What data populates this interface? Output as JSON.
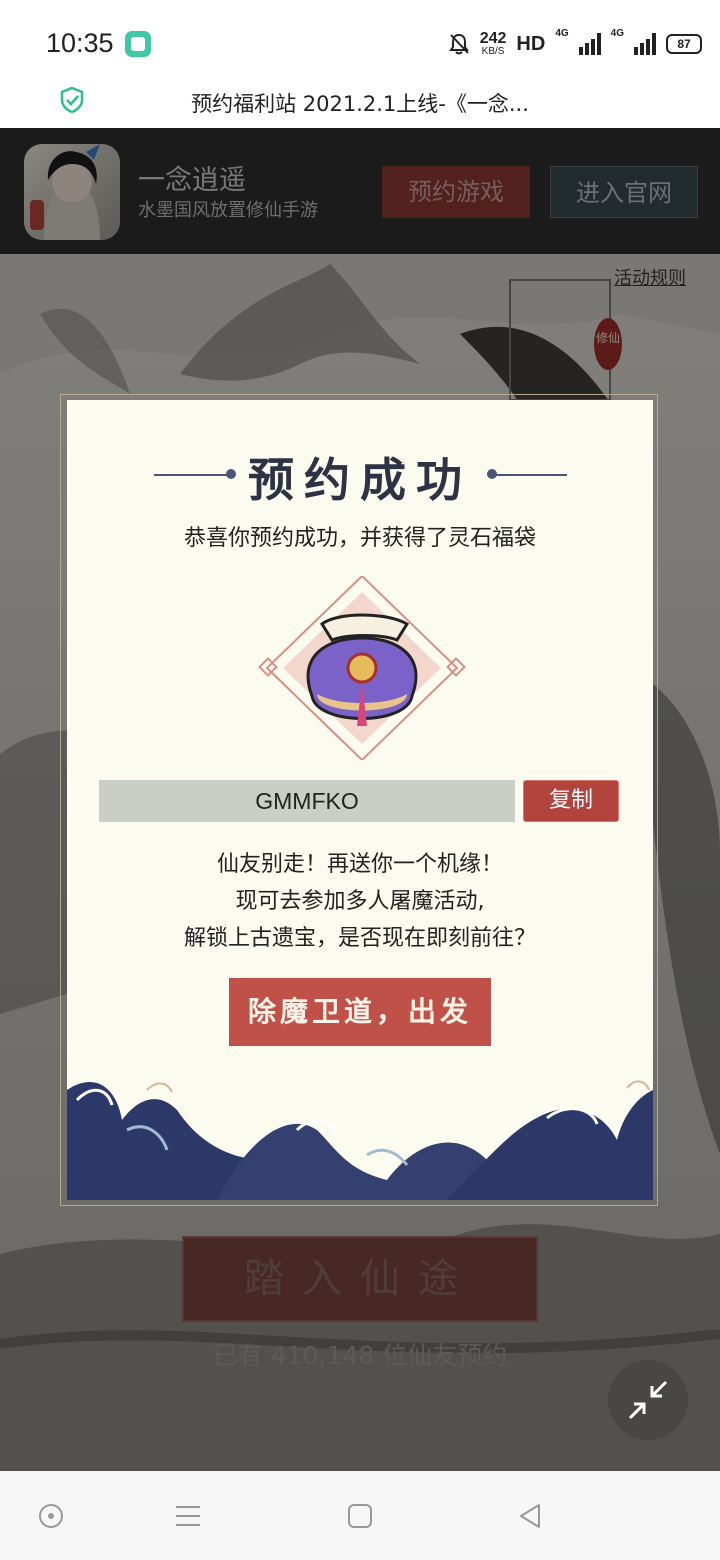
{
  "status_bar": {
    "time": "10:35",
    "speed_value": "242",
    "speed_unit": "KB/S",
    "hd_label": "HD",
    "net1": "4G",
    "net2": "4G",
    "battery": "87"
  },
  "url_bar": {
    "title": "预约福利站 2021.2.1上线-《一念..."
  },
  "header": {
    "game_name": "一念逍遥",
    "game_subtitle": "水墨国风放置修仙手游",
    "reserve_button": "预约游戏",
    "official_button": "进入官网"
  },
  "page": {
    "rules_link": "活动规则",
    "enter_button": "踏入仙途",
    "reserve_count": "已有 410,148 位仙友预约",
    "badge_text": "修仙"
  },
  "modal": {
    "title": "预约成功",
    "subtitle": "恭喜你预约成功，并获得了灵石福袋",
    "code": "GMMFKO",
    "copy_button": "复制",
    "message_line1": "仙友别走！再送你一个机缘！",
    "message_line2": "现可去参加多人屠魔活动,",
    "message_line3": "解锁上古遗宝，是否现在即刻前往？",
    "go_button": "除魔卫道，出发"
  },
  "colors": {
    "modal_bg": "#fcfbef",
    "accent_red": "#c05148",
    "title_navy": "#2e3245",
    "code_bg": "#c9cfc6"
  },
  "icons": [
    "app-icon",
    "mute-icon",
    "signal-icon",
    "battery-icon",
    "security-shield-icon",
    "lucky-bag-icon",
    "collapse-icon",
    "nav-home-icon",
    "nav-menu-icon",
    "nav-recent-icon",
    "nav-back-icon"
  ]
}
